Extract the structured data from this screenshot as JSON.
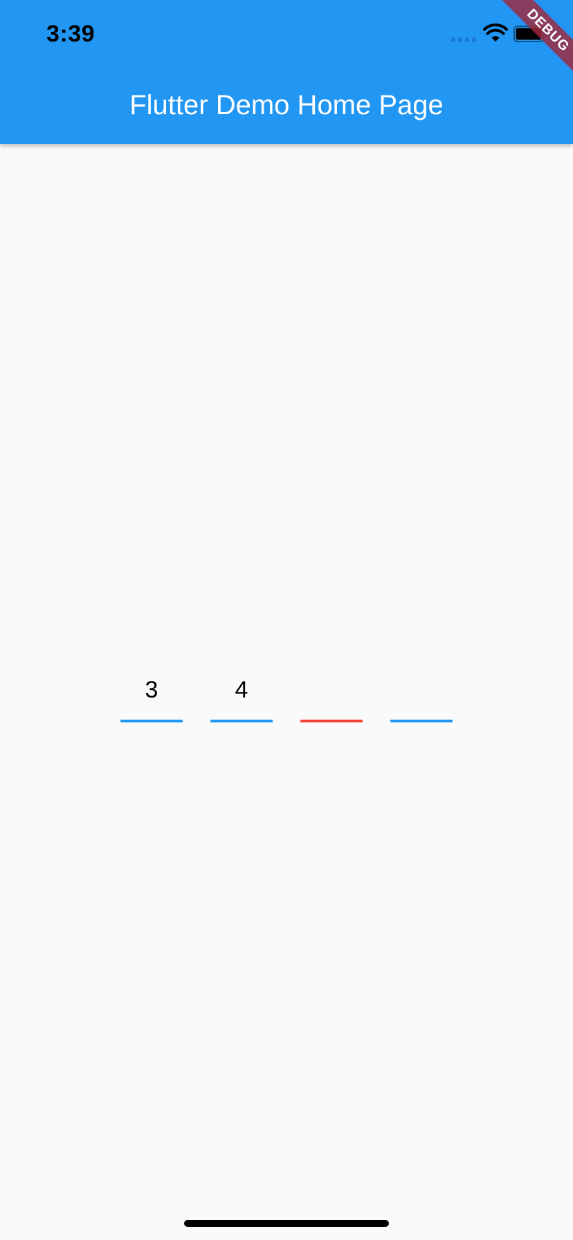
{
  "status_bar": {
    "time": "3:39"
  },
  "app_bar": {
    "title": "Flutter Demo Home Page"
  },
  "debug_banner": {
    "label": "DEBUG"
  },
  "pin": {
    "fields": [
      {
        "value": "3",
        "state": "filled",
        "underline_color": "#2196f3"
      },
      {
        "value": "4",
        "state": "filled",
        "underline_color": "#2196f3"
      },
      {
        "value": "",
        "state": "focused",
        "underline_color": "#f44336"
      },
      {
        "value": "",
        "state": "empty",
        "underline_color": "#2196f3"
      }
    ]
  },
  "colors": {
    "primary": "#2196f3",
    "accent_focus": "#f44336",
    "background": "#fafafa"
  },
  "icons": [
    "cellular-signal-icon",
    "wifi-icon",
    "battery-icon"
  ]
}
